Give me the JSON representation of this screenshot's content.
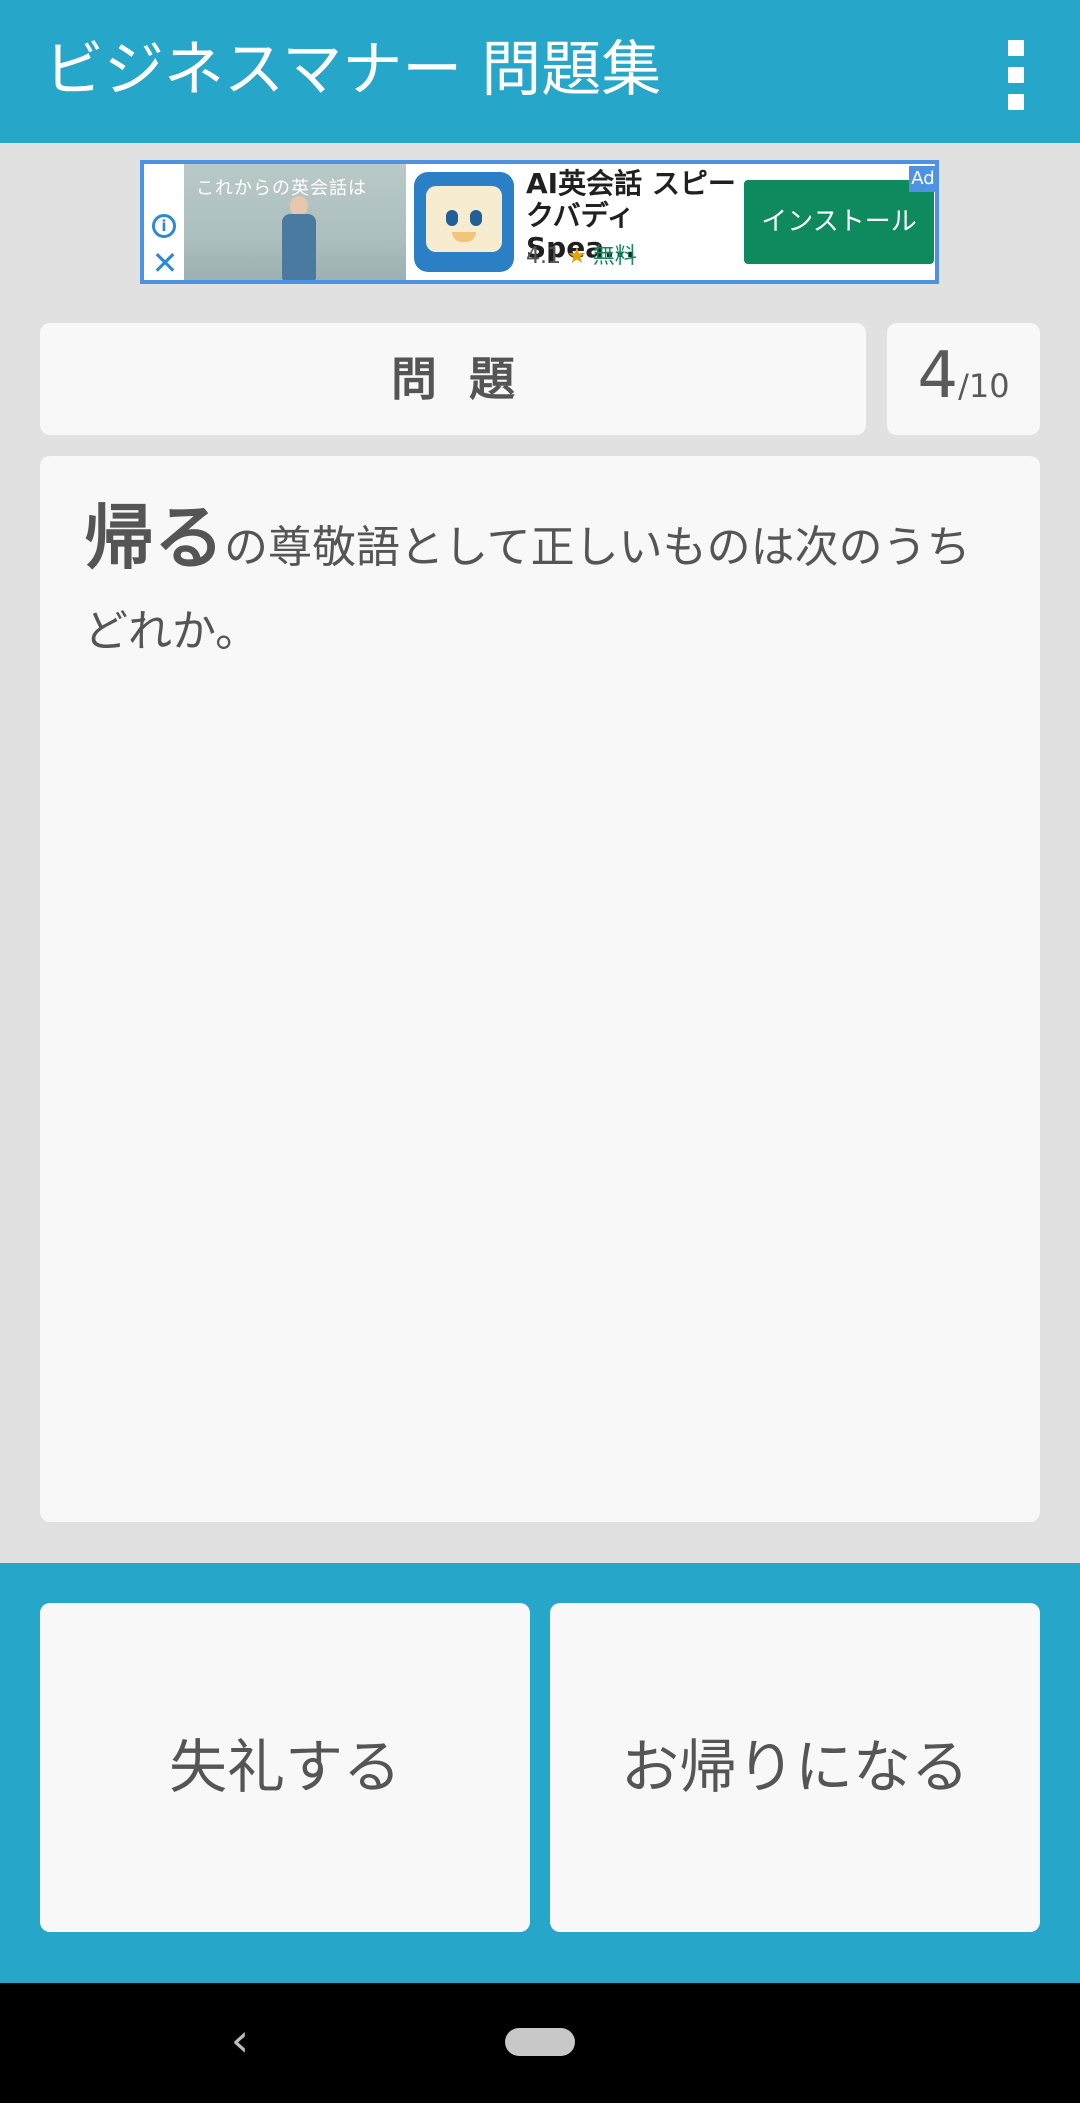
{
  "app": {
    "title": "ビジネスマナー 問題集"
  },
  "ad": {
    "photo_caption": "これからの英会話は",
    "app_name": "AI英会話 スピークバディ Spea...",
    "rating": "4.1",
    "price": "無料",
    "install_label": "インストール",
    "badge": "Ad"
  },
  "question": {
    "label": "問題",
    "current": "4",
    "total": "/10",
    "keyword": "帰る",
    "text": "の尊敬語として正しいものは次のうちどれか。"
  },
  "answers": [
    {
      "label": "失礼する"
    },
    {
      "label": "お帰りになる"
    }
  ],
  "nav": {
    "back_glyph": "‹"
  }
}
